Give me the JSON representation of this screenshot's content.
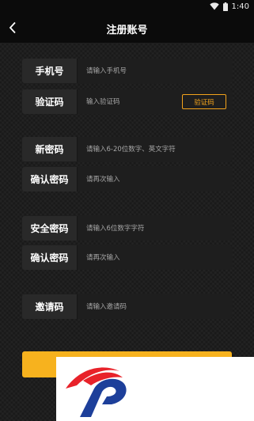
{
  "status_bar": {
    "time": "1:40",
    "icons": [
      "wifi-icon",
      "battery-icon"
    ]
  },
  "header": {
    "back_icon": "chevron-left-icon",
    "title": "注册账号"
  },
  "form": {
    "phone": {
      "label": "手机号",
      "placeholder": "请输入手机号"
    },
    "verification": {
      "label": "验证码",
      "placeholder": "输入验证码",
      "button_label": "验证码"
    },
    "new_password": {
      "label": "新密码",
      "placeholder": "请输入6-20位数字、英文字符"
    },
    "confirm_password": {
      "label": "确认密码",
      "placeholder": "请再次输入"
    },
    "security_password": {
      "label": "安全密码",
      "placeholder": "请输入6位数字字符"
    },
    "confirm_security_password": {
      "label": "确认密码",
      "placeholder": "请再次输入"
    },
    "invite_code": {
      "label": "邀请码",
      "placeholder": "请输入邀请码"
    }
  },
  "colors": {
    "accent": "#f7b21e",
    "accent_border": "#f3a31c",
    "logo_red": "#e8222a",
    "logo_blue": "#1d3f9a"
  },
  "watermark": {
    "icon": "brand-logo-icon"
  }
}
